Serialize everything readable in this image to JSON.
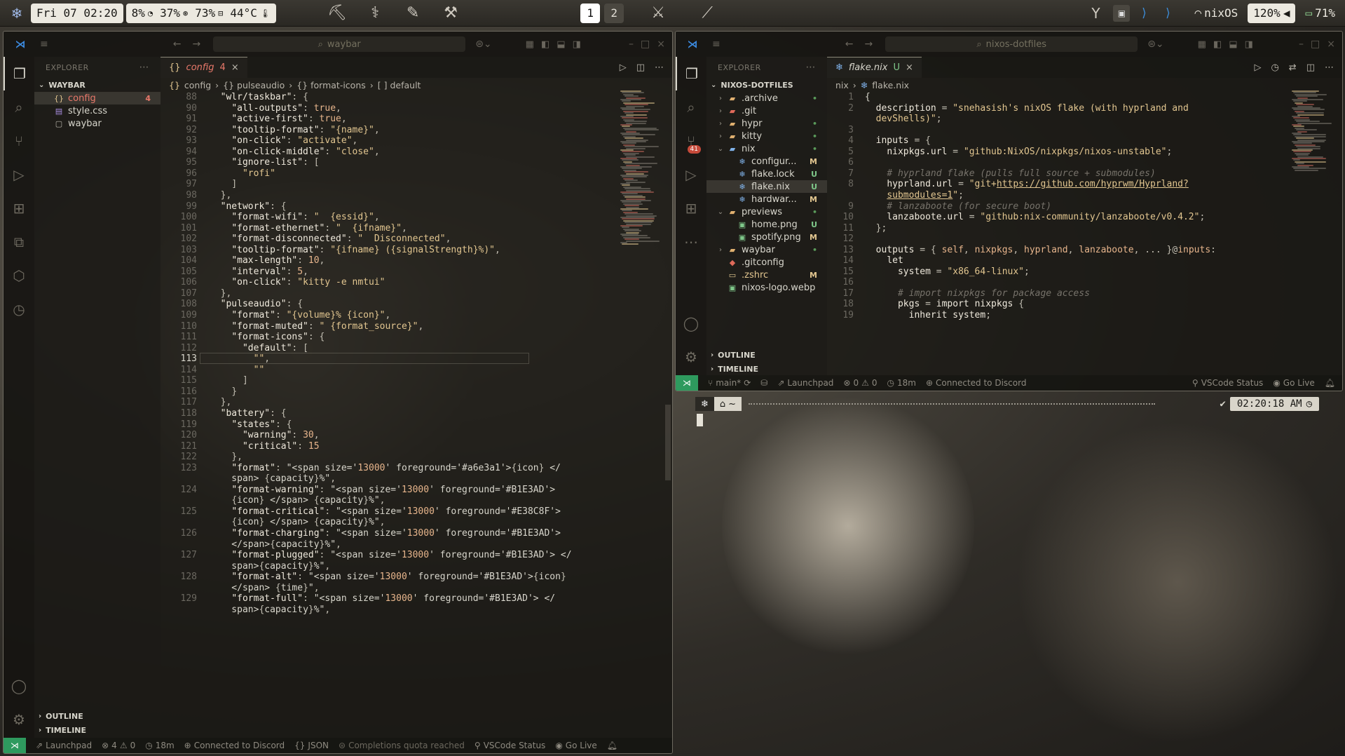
{
  "topbar": {
    "datetime": "Fri 07 02:20",
    "cpu": "8%",
    "memory": "37%",
    "disk": "73%",
    "temp": "44°C",
    "workspaces": [
      "1",
      "2"
    ],
    "wifi_name": "nixOS",
    "volume": "120%",
    "battery": "71%",
    "icons": [
      "nixos-snowflake-icon",
      "clock-icon",
      "memory-icon",
      "disk-icon",
      "thermometer-icon",
      "hyprland-icon",
      "wifi-icon",
      "speaker-icon",
      "battery-icon"
    ]
  },
  "left": {
    "title_search": "waybar",
    "explorer_label": "EXPLORER",
    "folder": "WAYBAR",
    "files": [
      {
        "name": "config",
        "status": "4",
        "color": "#e8786a"
      },
      {
        "name": "style.css",
        "status": "",
        "color": "#d8d6cc"
      },
      {
        "name": "waybar",
        "status": "",
        "color": "#d8d6cc"
      }
    ],
    "outline": "OUTLINE",
    "timeline": "TIMELINE",
    "tab_label": "config",
    "tab_count": "4",
    "crumbs": [
      "config",
      "{} pulseaudio",
      "{} format-icons",
      "[ ] default"
    ],
    "crumb_first_icon": "{}",
    "code": [
      {
        "n": "88",
        "t": "  \"wlr/taskbar\": {"
      },
      {
        "n": "90",
        "t": "    \"all-outputs\": true,"
      },
      {
        "n": "91",
        "t": "    \"active-first\": true,"
      },
      {
        "n": "92",
        "t": "    \"tooltip-format\": \"{name}\","
      },
      {
        "n": "93",
        "t": "    \"on-click\": \"activate\","
      },
      {
        "n": "94",
        "t": "    \"on-click-middle\": \"close\","
      },
      {
        "n": "95",
        "t": "    \"ignore-list\": ["
      },
      {
        "n": "96",
        "t": "      \"rofi\""
      },
      {
        "n": "97",
        "t": "    ]"
      },
      {
        "n": "98",
        "t": "  },"
      },
      {
        "n": "99",
        "t": "  \"network\": {"
      },
      {
        "n": "100",
        "t": "    \"format-wifi\": \"  {essid}\","
      },
      {
        "n": "101",
        "t": "    \"format-ethernet\": \"  {ifname}\","
      },
      {
        "n": "102",
        "t": "    \"format-disconnected\": \"  Disconnected\","
      },
      {
        "n": "103",
        "t": "    \"tooltip-format\": \"{ifname} ({signalStrength}%)\","
      },
      {
        "n": "104",
        "t": "    \"max-length\": 10,"
      },
      {
        "n": "105",
        "t": "    \"interval\": 5,"
      },
      {
        "n": "106",
        "t": "    \"on-click\": \"kitty -e nmtui\""
      },
      {
        "n": "107",
        "t": "  },"
      },
      {
        "n": "108",
        "t": "  \"pulseaudio\": {"
      },
      {
        "n": "109",
        "t": "    \"format\": \"{volume}% {icon}\","
      },
      {
        "n": "110",
        "t": "    \"format-muted\": \" {format_source}\","
      },
      {
        "n": "111",
        "t": "    \"format-icons\": {"
      },
      {
        "n": "112",
        "t": "      \"default\": ["
      },
      {
        "n": "113",
        "t": "        \"\","
      },
      {
        "n": "114",
        "t": "        \"\""
      },
      {
        "n": "115",
        "t": "      ]"
      },
      {
        "n": "116",
        "t": "    }"
      },
      {
        "n": "117",
        "t": "  },"
      },
      {
        "n": "118",
        "t": "  \"battery\": {"
      },
      {
        "n": "119",
        "t": "    \"states\": {"
      },
      {
        "n": "120",
        "t": "      \"warning\": 30,"
      },
      {
        "n": "121",
        "t": "      \"critical\": 15"
      },
      {
        "n": "122",
        "t": "    },"
      },
      {
        "n": "123",
        "t": "    \"format\": \"<span size='13000' foreground='#a6e3a1'>{icon} </"
      },
      {
        "n": "",
        "t": "    span> {capacity}%\","
      },
      {
        "n": "124",
        "t": "    \"format-warning\": \"<span size='13000' foreground='#B1E3AD'>"
      },
      {
        "n": "",
        "t": "    {icon} </span> {capacity}%\","
      },
      {
        "n": "125",
        "t": "    \"format-critical\": \"<span size='13000' foreground='#E38C8F'>"
      },
      {
        "n": "",
        "t": "    {icon} </span> {capacity}%\","
      },
      {
        "n": "126",
        "t": "    \"format-charging\": \"<span size='13000' foreground='#B1E3AD'>"
      },
      {
        "n": "",
        "t": "    </span>{capacity}%\","
      },
      {
        "n": "127",
        "t": "    \"format-plugged\": \"<span size='13000' foreground='#B1E3AD'> </"
      },
      {
        "n": "",
        "t": "    span>{capacity}%\","
      },
      {
        "n": "128",
        "t": "    \"format-alt\": \"<span size='13000' foreground='#B1E3AD'>{icon}"
      },
      {
        "n": "",
        "t": "    </span> {time}\","
      },
      {
        "n": "129",
        "t": "    \"format-full\": \"<span size='13000' foreground='#B1E3AD'> </"
      },
      {
        "n": "",
        "t": "    span>{capacity}%\","
      }
    ],
    "current_line": "113",
    "status": {
      "launchpad": "Launchpad",
      "problems": "4",
      "warnings": "0",
      "time": "18m",
      "discord": "Connected to Discord",
      "lang": "JSON",
      "completions": "Completions quota reached",
      "vscode_status": "VSCode Status",
      "golive": "Go Live"
    }
  },
  "right": {
    "title_search": "nixos-dotfiles",
    "explorer_label": "EXPLORER",
    "folder": "NIXOS-DOTFILES",
    "tree": [
      {
        "name": ".archive",
        "depth": 0,
        "kind": "folder",
        "chev": "›",
        "status": "•",
        "color": "#d8d6cc",
        "scolor": "#5a9a5a"
      },
      {
        "name": ".git",
        "depth": 0,
        "kind": "gitfolder",
        "chev": "›",
        "status": "",
        "color": "#d8d6cc",
        "scolor": ""
      },
      {
        "name": "hypr",
        "depth": 0,
        "kind": "folder",
        "chev": "›",
        "status": "•",
        "color": "#d8d6cc",
        "scolor": "#5a9a5a"
      },
      {
        "name": "kitty",
        "depth": 0,
        "kind": "folder",
        "chev": "›",
        "status": "•",
        "color": "#d8d6cc",
        "scolor": "#5a9a5a"
      },
      {
        "name": "nix",
        "depth": 0,
        "kind": "nixfolder",
        "chev": "⌄",
        "status": "•",
        "color": "#d8d6cc",
        "scolor": "#5a9a5a"
      },
      {
        "name": "configur...",
        "depth": 1,
        "kind": "nix",
        "chev": "",
        "status": "M",
        "color": "#d8d6cc",
        "scolor": "#e2c690"
      },
      {
        "name": "flake.lock",
        "depth": 1,
        "kind": "nix",
        "chev": "",
        "status": "U",
        "color": "#d8d6cc",
        "scolor": "#7fc88a"
      },
      {
        "name": "flake.nix",
        "depth": 1,
        "kind": "nix",
        "chev": "",
        "status": "U",
        "color": "#d8d6cc",
        "scolor": "#7fc88a",
        "sel": true
      },
      {
        "name": "hardwar...",
        "depth": 1,
        "kind": "nix",
        "chev": "",
        "status": "M",
        "color": "#d8d6cc",
        "scolor": "#e2c690"
      },
      {
        "name": "previews",
        "depth": 0,
        "kind": "folder",
        "chev": "⌄",
        "status": "•",
        "color": "#d8d6cc",
        "scolor": "#5a9a5a"
      },
      {
        "name": "home.png",
        "depth": 1,
        "kind": "img",
        "chev": "",
        "status": "U",
        "color": "#d8d6cc",
        "scolor": "#7fc88a"
      },
      {
        "name": "spotify.png",
        "depth": 1,
        "kind": "img",
        "chev": "",
        "status": "M",
        "color": "#d8d6cc",
        "scolor": "#e2c690"
      },
      {
        "name": "waybar",
        "depth": 0,
        "kind": "folder",
        "chev": "›",
        "status": "•",
        "color": "#d8d6cc",
        "scolor": "#5a9a5a"
      },
      {
        "name": ".gitconfig",
        "depth": 0,
        "kind": "git",
        "chev": "",
        "status": "",
        "color": "#d8d6cc",
        "scolor": ""
      },
      {
        "name": ".zshrc",
        "depth": 0,
        "kind": "sh",
        "chev": "",
        "status": "M",
        "color": "#e2c690",
        "scolor": "#e2c690"
      },
      {
        "name": "nixos-logo.webp",
        "depth": 0,
        "kind": "img",
        "chev": "",
        "status": "",
        "color": "#d8d6cc",
        "scolor": ""
      }
    ],
    "outline": "OUTLINE",
    "timeline": "TIMELINE",
    "tab_label": "flake.nix",
    "tab_status": "U",
    "crumbs": [
      "nix",
      "flake.nix"
    ],
    "scm_badge": "41",
    "code": [
      {
        "n": "1",
        "h": "{",
        "cls": "p"
      },
      {
        "n": "2",
        "h": "  <span class='k'>description</span> <span class='p'>=</span> <span class='s'>\"snehasish's nixOS flake (with hyprland and</span>"
      },
      {
        "n": "",
        "h": "  <span class='s'>devShells)\"</span><span class='p'>;</span>"
      },
      {
        "n": "3",
        "h": ""
      },
      {
        "n": "4",
        "h": "  <span class='k'>inputs</span> <span class='p'>= {</span>"
      },
      {
        "n": "5",
        "h": "    <span class='k'>nixpkgs.url</span> <span class='p'>=</span> <span class='s'>\"github:NixOS/nixpkgs/nixos-unstable\"</span><span class='p'>;</span>"
      },
      {
        "n": "6",
        "h": ""
      },
      {
        "n": "7",
        "h": "    <span class='c'># hyprland flake (pulls full source + submodules)</span>"
      },
      {
        "n": "8",
        "h": "    <span class='k'>hyprland.url</span> <span class='p'>=</span> <span class='s'>\"git+</span><span class='u'>https://github.com/hyprwm/Hyprland?</span>"
      },
      {
        "n": "",
        "h": "    <span class='u'>submodules=1</span><span class='s'>\"</span><span class='p'>;</span>"
      },
      {
        "n": "9",
        "h": "    <span class='c'># lanzaboote (for secure boot)</span>"
      },
      {
        "n": "10",
        "h": "    <span class='k'>lanzaboote.url</span> <span class='p'>=</span> <span class='s'>\"github:nix-community/lanzaboote/v0.4.2\"</span><span class='p'>;</span>"
      },
      {
        "n": "11",
        "h": "  <span class='p'>};</span>"
      },
      {
        "n": "12",
        "h": ""
      },
      {
        "n": "13",
        "h": "  <span class='k'>outputs</span> <span class='p'>= {</span> <span class='n'>self</span><span class='p'>,</span> <span class='n'>nixpkgs</span><span class='p'>,</span> <span class='n'>hyprland</span><span class='p'>,</span> <span class='n'>lanzaboote</span><span class='p'>, ... }@</span><span class='n'>inputs</span><span class='p'>:</span>"
      },
      {
        "n": "14",
        "h": "    <span class='kw'>let</span>"
      },
      {
        "n": "15",
        "h": "      <span class='k'>system</span> <span class='p'>=</span> <span class='s'>\"x86_64-linux\"</span><span class='p'>;</span>"
      },
      {
        "n": "16",
        "h": ""
      },
      {
        "n": "17",
        "h": "      <span class='c'># import nixpkgs for package access</span>"
      },
      {
        "n": "18",
        "h": "      <span class='k'>pkgs</span> <span class='p'>=</span> <span class='kw'>import</span> <span class='k'>nixpkgs</span> <span class='p'>{</span>"
      },
      {
        "n": "19",
        "h": "        <span class='kw'>inherit</span> <span class='k'>system</span><span class='p'>;</span>"
      }
    ],
    "status": {
      "branch": "main*",
      "launchpad": "Launchpad",
      "problems": "0",
      "warnings": "0",
      "time": "18m",
      "discord": "Connected to Discord",
      "vscode_status": "VSCode Status",
      "golive": "Go Live"
    }
  },
  "terminal": {
    "prompt_icon": "nixos-snowflake-icon",
    "dir": "~",
    "check": "✔",
    "time": "02:20:18 AM"
  },
  "colors": {
    "accent": "#3c8be0",
    "remote": "#2e9a5e",
    "error": "#e8786a",
    "untracked": "#7fc88a",
    "modified": "#e2c690"
  }
}
